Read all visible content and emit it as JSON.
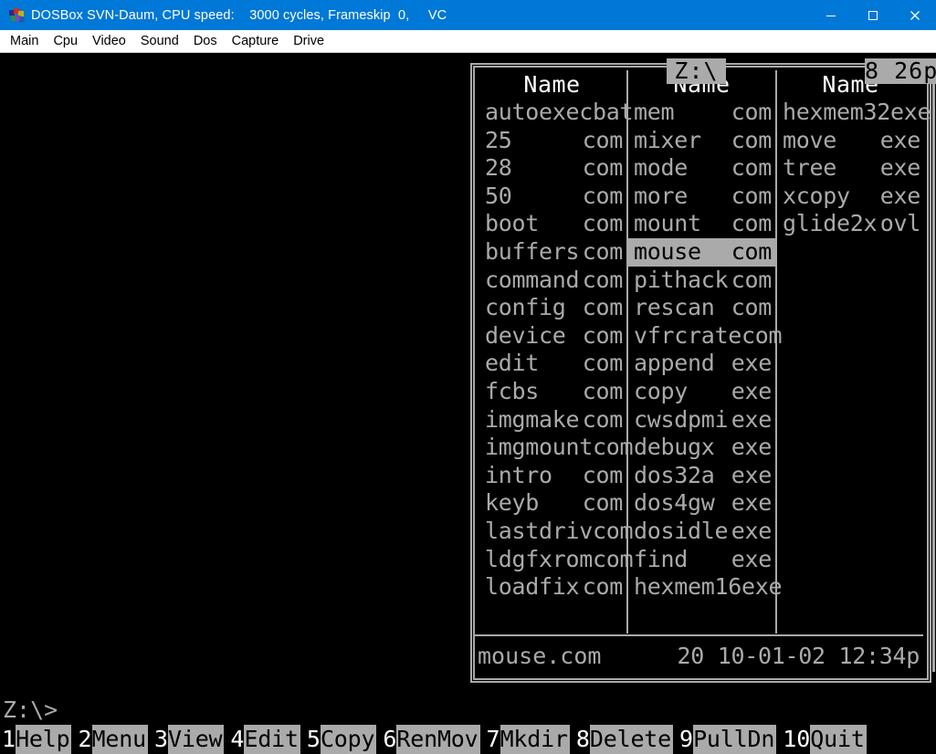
{
  "window": {
    "title": "DOSBox SVN-Daum, CPU speed:    3000 cycles, Frameskip  0,     VC",
    "icon": "dosbox-logo-icon",
    "minimize_label": "minimize-icon",
    "maximize_label": "maximize-icon",
    "close_label": "close-icon"
  },
  "menubar": {
    "items": [
      {
        "label": "Main"
      },
      {
        "label": "Cpu"
      },
      {
        "label": "Video"
      },
      {
        "label": "Sound"
      },
      {
        "label": "Dos"
      },
      {
        "label": "Capture"
      },
      {
        "label": "Drive"
      }
    ]
  },
  "panel": {
    "title": "Z:\\",
    "clock": "8 26p",
    "column_header": "Name",
    "columns": [
      {
        "files": [
          {
            "name": "autoexec",
            "ext": "bat",
            "selected": false
          },
          {
            "name": "25",
            "ext": "com",
            "selected": false
          },
          {
            "name": "28",
            "ext": "com",
            "selected": false
          },
          {
            "name": "50",
            "ext": "com",
            "selected": false
          },
          {
            "name": "boot",
            "ext": "com",
            "selected": false
          },
          {
            "name": "buffers",
            "ext": "com",
            "selected": false
          },
          {
            "name": "command",
            "ext": "com",
            "selected": false
          },
          {
            "name": "config",
            "ext": "com",
            "selected": false
          },
          {
            "name": "device",
            "ext": "com",
            "selected": false
          },
          {
            "name": "edit",
            "ext": "com",
            "selected": false
          },
          {
            "name": "fcbs",
            "ext": "com",
            "selected": false
          },
          {
            "name": "imgmake",
            "ext": "com",
            "selected": false
          },
          {
            "name": "imgmount",
            "ext": "com",
            "selected": false
          },
          {
            "name": "intro",
            "ext": "com",
            "selected": false
          },
          {
            "name": "keyb",
            "ext": "com",
            "selected": false
          },
          {
            "name": "lastdriv",
            "ext": "com",
            "selected": false
          },
          {
            "name": "ldgfxrom",
            "ext": "com",
            "selected": false
          },
          {
            "name": "loadfix",
            "ext": "com",
            "selected": false
          }
        ]
      },
      {
        "files": [
          {
            "name": "mem",
            "ext": "com",
            "selected": false
          },
          {
            "name": "mixer",
            "ext": "com",
            "selected": false
          },
          {
            "name": "mode",
            "ext": "com",
            "selected": false
          },
          {
            "name": "more",
            "ext": "com",
            "selected": false
          },
          {
            "name": "mount",
            "ext": "com",
            "selected": false
          },
          {
            "name": "mouse",
            "ext": "com",
            "selected": true
          },
          {
            "name": "pithack",
            "ext": "com",
            "selected": false
          },
          {
            "name": "rescan",
            "ext": "com",
            "selected": false
          },
          {
            "name": "vfrcrate",
            "ext": "com",
            "selected": false
          },
          {
            "name": "append",
            "ext": "exe",
            "selected": false
          },
          {
            "name": "copy",
            "ext": "exe",
            "selected": false
          },
          {
            "name": "cwsdpmi",
            "ext": "exe",
            "selected": false
          },
          {
            "name": "debugx",
            "ext": "exe",
            "selected": false
          },
          {
            "name": "dos32a",
            "ext": "exe",
            "selected": false
          },
          {
            "name": "dos4gw",
            "ext": "exe",
            "selected": false
          },
          {
            "name": "dosidle",
            "ext": "exe",
            "selected": false
          },
          {
            "name": "find",
            "ext": "exe",
            "selected": false
          },
          {
            "name": "hexmem16",
            "ext": "exe",
            "selected": false
          }
        ]
      },
      {
        "files": [
          {
            "name": "hexmem32",
            "ext": "exe",
            "selected": false
          },
          {
            "name": "move",
            "ext": "exe",
            "selected": false
          },
          {
            "name": "tree",
            "ext": "exe",
            "selected": false
          },
          {
            "name": "xcopy",
            "ext": "exe",
            "selected": false
          },
          {
            "name": "glide2x",
            "ext": "ovl",
            "selected": false
          }
        ]
      }
    ],
    "status": {
      "filename": "mouse.com",
      "size": "20",
      "date": "10-01-02",
      "time": "12:34p"
    }
  },
  "shell": {
    "prompt": "Z:\\>"
  },
  "function_keys": [
    {
      "num": "1",
      "label": "Help"
    },
    {
      "num": "2",
      "label": "Menu"
    },
    {
      "num": "3",
      "label": "View"
    },
    {
      "num": "4",
      "label": "Edit"
    },
    {
      "num": "5",
      "label": "Copy"
    },
    {
      "num": "6",
      "label": "RenMov"
    },
    {
      "num": "7",
      "label": "Mkdir"
    },
    {
      "num": "8",
      "label": "Delete"
    },
    {
      "num": "9",
      "label": "PullDn"
    },
    {
      "num": "10",
      "label": "Quit"
    }
  ],
  "colors": {
    "titlebar": "#0078d7",
    "dos_background": "#000000",
    "dos_foreground": "#aaaaaa",
    "highlight": "#aaaaaa",
    "bright_white": "#ffffff"
  }
}
